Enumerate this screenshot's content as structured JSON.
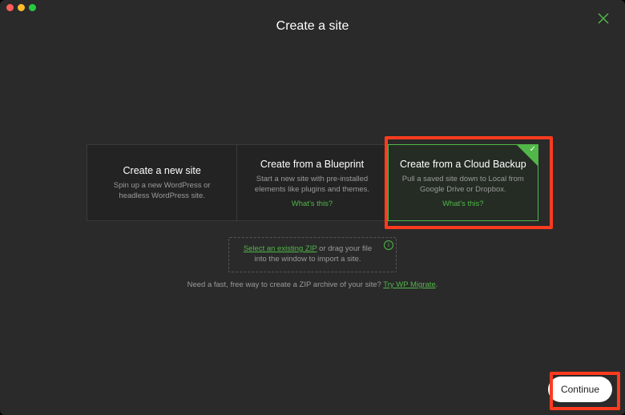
{
  "header": {
    "title": "Create a site"
  },
  "options": [
    {
      "title": "Create a new site",
      "desc": "Spin up a new WordPress or headless WordPress site.",
      "hint": "",
      "selected": false
    },
    {
      "title": "Create from a Blueprint",
      "desc": "Start a new site with pre-installed elements like plugins and themes.",
      "hint": "What's this?",
      "selected": false
    },
    {
      "title": "Create from a Cloud Backup",
      "desc": "Pull a saved site down to Local from Google Drive or Dropbox.",
      "hint": "What's this?",
      "selected": true
    }
  ],
  "dropzone": {
    "link_text": "Select an existing ZIP",
    "rest_text": " or drag your file into the window to import a site."
  },
  "migrate": {
    "lead": "Need a fast, free way to create a ZIP archive of your site? ",
    "link": "Try WP Migrate",
    "trail": "."
  },
  "footer": {
    "continue_label": "Continue"
  },
  "colors": {
    "accent": "#51b749",
    "highlight": "#ff3b1f",
    "bg": "#2a2a2a"
  }
}
